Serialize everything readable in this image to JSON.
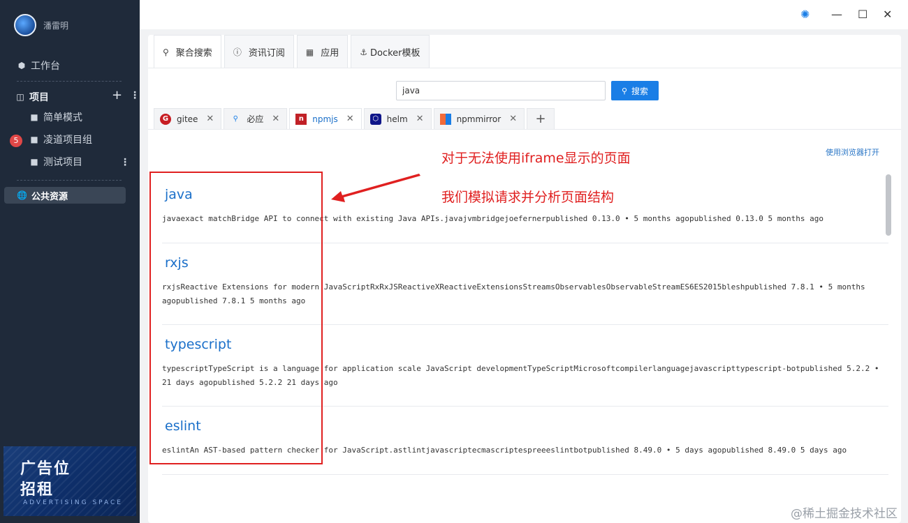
{
  "user": {
    "name": "潘雷明"
  },
  "sidebar": {
    "workspace": "工作台",
    "projects": "项目",
    "items": [
      {
        "label": "简单模式"
      },
      {
        "label": "凌道项目组",
        "badge": "5"
      },
      {
        "label": "测试项目"
      }
    ],
    "public_resources": "公共资源"
  },
  "ad": {
    "line1": "广告位",
    "line2": "招租",
    "line3": "ADVERTISING SPACE"
  },
  "main_tabs": [
    {
      "label": "聚合搜索",
      "icon": "search-icon",
      "active": true
    },
    {
      "label": "资讯订阅",
      "icon": "info-icon"
    },
    {
      "label": "应用",
      "icon": "grid-icon"
    },
    {
      "label": "Docker模板",
      "icon": "docker-icon"
    }
  ],
  "search": {
    "value": "java",
    "button_label": "搜索"
  },
  "source_tabs": [
    {
      "label": "gitee",
      "color": "#c71d23"
    },
    {
      "label": "必应",
      "color": "#1a7ee6"
    },
    {
      "label": "npmjs",
      "color": "#c12127",
      "active": true
    },
    {
      "label": "helm",
      "color": "#0f1689"
    },
    {
      "label": "npmmirror",
      "color": "#f26b3a"
    }
  ],
  "open_in_browser": "使用浏览器打开",
  "annotations": {
    "line1": "对于无法使用iframe显示的页面",
    "line2": "我们模拟请求并分析页面结构"
  },
  "results": [
    {
      "title": "java",
      "desc": "javaexact matchBridge API to connect with existing Java APIs.javajvmbridgejoefernerpublished 0.13.0 • 5 months agopublished 0.13.0 5 months ago"
    },
    {
      "title": "rxjs",
      "desc": "rxjsReactive Extensions for modern JavaScriptRxRxJSReactiveXReactiveExtensionsStreamsObservablesObservableStreamES6ES2015bleshpublished 7.8.1 • 5 months agopublished 7.8.1 5 months ago"
    },
    {
      "title": "typescript",
      "desc": "typescriptTypeScript is a language for application scale JavaScript developmentTypeScriptMicrosoftcompilerlanguagejavascripttypescript-botpublished 5.2.2 • 21 days agopublished 5.2.2 21 days ago"
    },
    {
      "title": "eslint",
      "desc": "eslintAn AST-based pattern checker for JavaScript.astlintjavascriptecmascriptespreeeslintbotpublished 8.49.0 • 5 days agopublished 8.49.0 5 days ago"
    }
  ],
  "watermark": "@稀土掘金技术社区",
  "colors": {
    "sidebar_bg": "#1f2a3a",
    "accent": "#1a7ee6",
    "annotation_red": "#e02020",
    "badge_red": "#e04747"
  }
}
